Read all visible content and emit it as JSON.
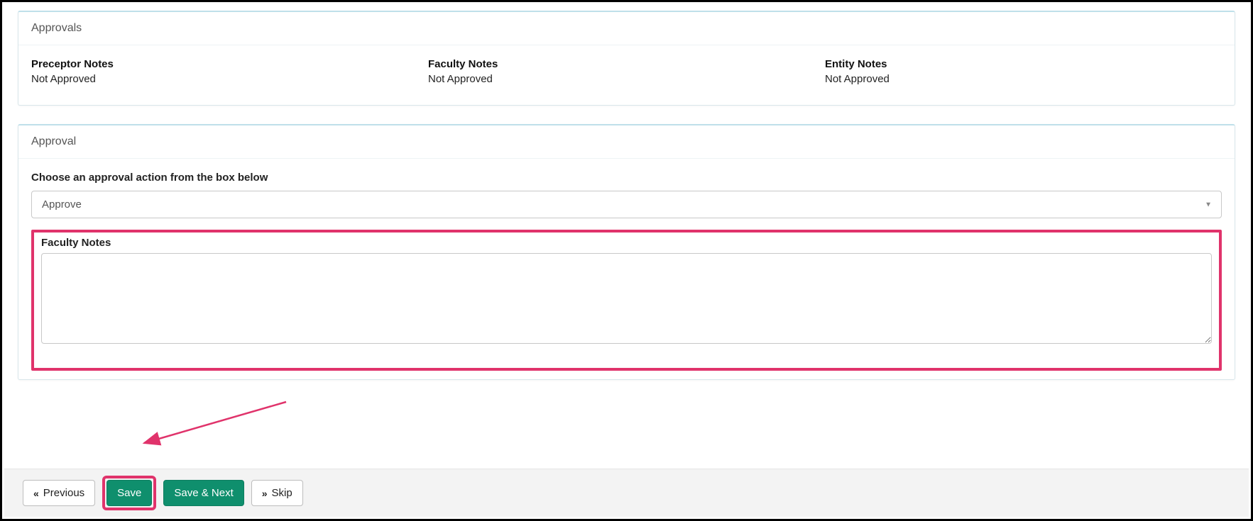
{
  "approvals_panel": {
    "title": "Approvals",
    "preceptor": {
      "label": "Preceptor Notes",
      "status": "Not Approved"
    },
    "faculty": {
      "label": "Faculty Notes",
      "status": "Not Approved"
    },
    "entity": {
      "label": "Entity Notes",
      "status": "Not Approved"
    }
  },
  "approval_panel": {
    "title": "Approval",
    "instruction": "Choose an approval action from the box below",
    "selected_option": "Approve",
    "faculty_notes_label": "Faculty Notes",
    "faculty_notes_value": ""
  },
  "footer": {
    "previous": "Previous",
    "save": "Save",
    "save_next": "Save & Next",
    "skip": "Skip"
  },
  "icons": {
    "prev": "«",
    "next": "»",
    "caret": "▼"
  },
  "colors": {
    "accent_green": "#0f8f6d",
    "highlight_pink": "#e0336b"
  }
}
